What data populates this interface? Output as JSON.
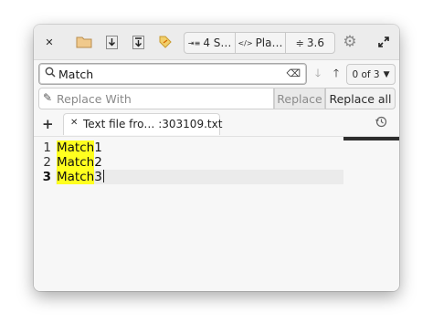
{
  "toolbar": {
    "close_icon": "close-icon",
    "folder_icon": "folder-icon",
    "download_icon": "download-icon",
    "save_as_icon": "save-as-icon",
    "tag_icon": "tag-icon",
    "indent_label": "4 S…",
    "syntax_label": "Pla…",
    "spacing_label": "3.6",
    "settings_icon": "gear-icon",
    "expand_icon": "expand-icon"
  },
  "find": {
    "value": "Match",
    "counter": "0 of 3"
  },
  "replace": {
    "placeholder": "Replace With",
    "replace_label": "Replace",
    "replace_all_label": "Replace all"
  },
  "tabs": {
    "items": [
      {
        "label": "Text file fro… :303109.txt"
      }
    ]
  },
  "editor": {
    "lines": [
      {
        "number": "1",
        "match": "Match",
        "rest": "1"
      },
      {
        "number": "2",
        "match": "Match",
        "rest": "2"
      },
      {
        "number": "3",
        "match": "Match",
        "rest": "3"
      }
    ],
    "current_line": 3,
    "highlight_color": "#ffff1f"
  }
}
